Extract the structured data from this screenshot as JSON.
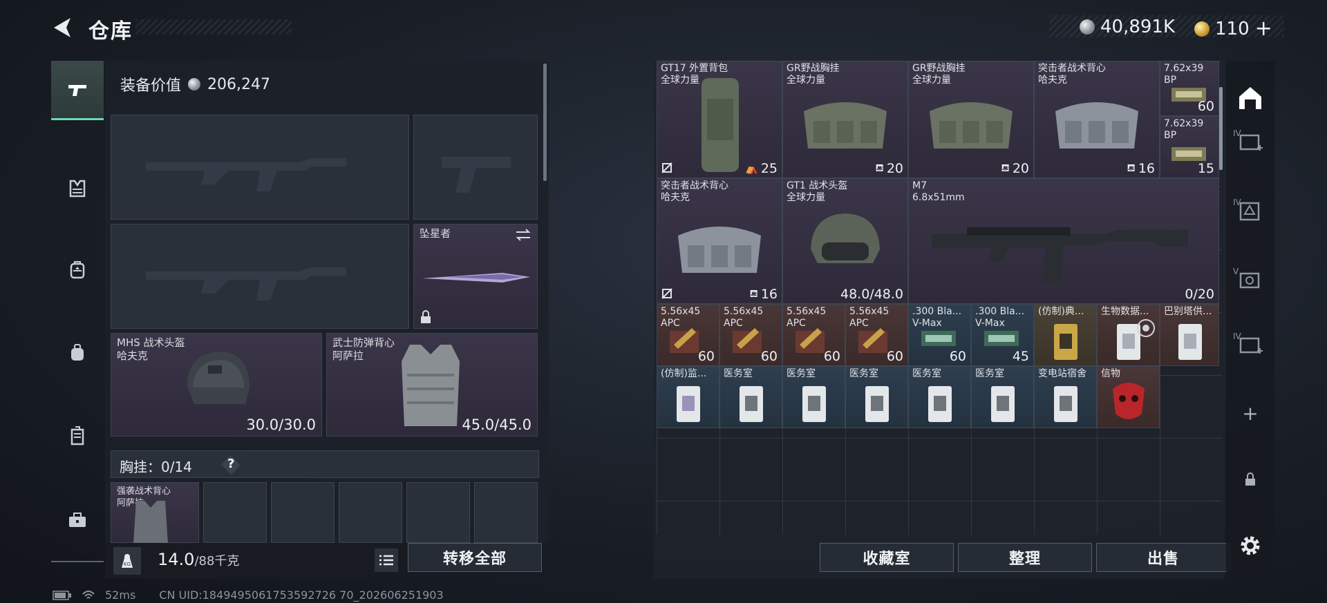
{
  "header": {
    "title": "仓库",
    "currency_silver": "40,891K",
    "currency_gold": "110",
    "add_symbol": "+"
  },
  "equipment": {
    "value_label": "装备价值",
    "value": "206,247",
    "melee": {
      "name": "坠星者"
    },
    "helmet": {
      "name": "MHS 战术头盔",
      "brand": "哈夫克",
      "durability": "30.0/30.0"
    },
    "armor": {
      "name": "武士防弹背心",
      "brand": "阿萨拉",
      "durability": "45.0/45.0"
    },
    "chest": {
      "label": "胸挂：0/14",
      "help": "?"
    },
    "chest_item": {
      "name": "强袭战术背心",
      "brand": "阿萨拉"
    }
  },
  "footer_left": {
    "weight": "14.0",
    "weight_max": "/88千克",
    "transfer_all": "转移全部"
  },
  "inventory": {
    "row1": [
      {
        "name": "GT17 外置背包",
        "brand": "全球力量",
        "cap": "25"
      },
      {
        "name": "GR野战胸挂",
        "brand": "全球力量",
        "cap": "20"
      },
      {
        "name": "GR野战胸挂",
        "brand": "全球力量",
        "cap": "20"
      },
      {
        "name": "突击者战术背心",
        "brand": "哈夫克",
        "cap": "16"
      },
      {
        "name": "7.62x39",
        "brand": "BP",
        "count": "60"
      },
      {
        "name": "7.62x39",
        "brand": "BP",
        "count": "15"
      }
    ],
    "row2": [
      {
        "name": "突击者战术背心",
        "brand": "哈夫克",
        "cap": "16"
      },
      {
        "name": "GT1 战术头盔",
        "brand": "全球力量",
        "durability": "48.0/48.0"
      },
      {
        "name": "M7",
        "brand": "6.8x51mm",
        "ammo": "0/20"
      }
    ],
    "row3": [
      {
        "name": "5.56x45",
        "brand": "APC",
        "count": "60"
      },
      {
        "name": "5.56x45",
        "brand": "APC",
        "count": "60"
      },
      {
        "name": "5.56x45",
        "brand": "APC",
        "count": "60"
      },
      {
        "name": "5.56x45",
        "brand": "APC",
        "count": "60"
      },
      {
        "name": ".300 Bla...",
        "brand": "V-Max",
        "count": "60"
      },
      {
        "name": ".300 Bla...",
        "brand": "V-Max",
        "count": "45"
      },
      {
        "name": "(仿制)典...",
        "brand": ""
      },
      {
        "name": "生物数据...",
        "brand": ""
      },
      {
        "name": "巴别塔供...",
        "brand": ""
      }
    ],
    "row4": [
      {
        "name": "(仿制)监..."
      },
      {
        "name": "医务室"
      },
      {
        "name": "医务室"
      },
      {
        "name": "医务室"
      },
      {
        "name": "医务室"
      },
      {
        "name": "医务室"
      },
      {
        "name": "变电站宿舍"
      },
      {
        "name": "信物"
      }
    ]
  },
  "footer_right": {
    "collection": "收藏室",
    "organize": "整理",
    "sell": "出售"
  },
  "side": {
    "tab1": "IV",
    "tab2": "IV",
    "tab3": "V",
    "tab4": "IV",
    "plus": "+"
  },
  "status": {
    "ping": "52ms",
    "uid": "CN UID:1849495061753592726 70_202606251903"
  }
}
